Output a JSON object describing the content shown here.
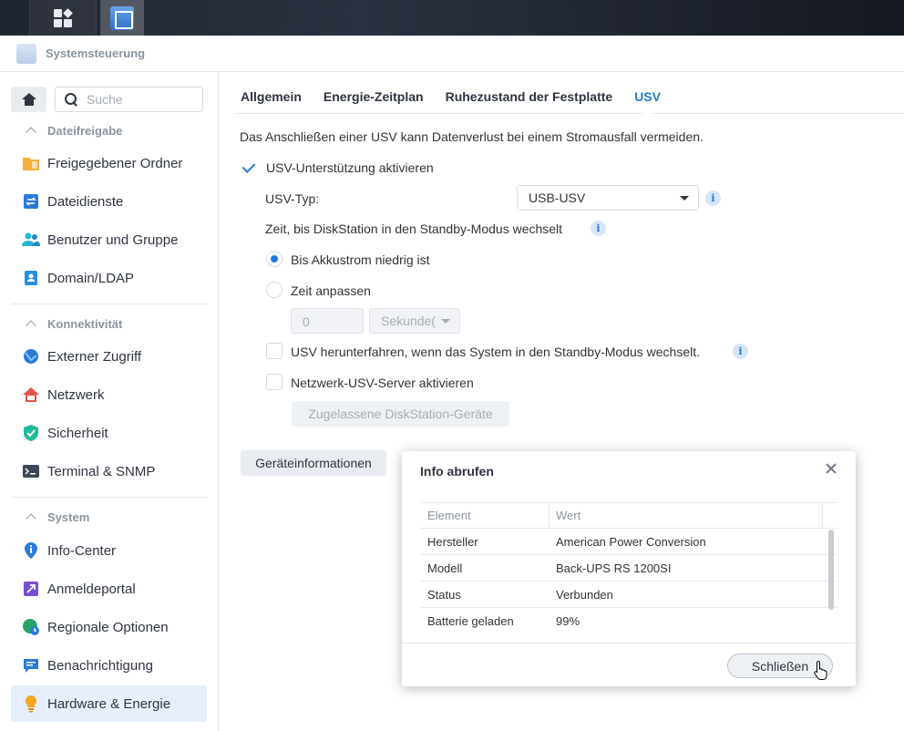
{
  "window": {
    "title": "Systemsteuerung"
  },
  "sidebar": {
    "search_placeholder": "Suche",
    "sections": {
      "dateifreigabe": "Dateifreigabe",
      "konnektivitaet": "Konnektivität",
      "system": "System"
    },
    "items": [
      {
        "label": "Freigegebener Ordner",
        "icon": "folder-icon",
        "color": "#f5a623"
      },
      {
        "label": "Dateidienste",
        "icon": "file-services-icon",
        "color": "#2b7ad8"
      },
      {
        "label": "Benutzer und Gruppe",
        "icon": "users-icon",
        "color": "#2bb3d9"
      },
      {
        "label": "Domain/LDAP",
        "icon": "id-card-icon",
        "color": "#2b8fe0"
      },
      {
        "label": "Externer Zugriff",
        "icon": "globe-link-icon",
        "color": "#2b7ad8"
      },
      {
        "label": "Netzwerk",
        "icon": "house-network-icon",
        "color": "#e2554a"
      },
      {
        "label": "Sicherheit",
        "icon": "shield-check-icon",
        "color": "#1fb99a"
      },
      {
        "label": "Terminal & SNMP",
        "icon": "terminal-icon",
        "color": "#3c4656"
      },
      {
        "label": "Info-Center",
        "icon": "info-pin-icon",
        "color": "#2b7ad8"
      },
      {
        "label": "Anmeldeportal",
        "icon": "portal-arrow-icon",
        "color": "#7a4fd0"
      },
      {
        "label": "Regionale Optionen",
        "icon": "globe-clock-icon",
        "color": "#2aa36b"
      },
      {
        "label": "Benachrichtigung",
        "icon": "chat-bubble-icon",
        "color": "#2b7ad8"
      },
      {
        "label": "Hardware & Energie",
        "icon": "lightbulb-icon",
        "color": "#f5a623",
        "active": true
      }
    ]
  },
  "tabs": [
    {
      "label": "Allgemein"
    },
    {
      "label": "Energie-Zeitplan"
    },
    {
      "label": "Ruhezustand der Festplatte"
    },
    {
      "label": "USV",
      "active": true
    }
  ],
  "usv": {
    "intro": "Das Anschließen einer USV kann Datenverlust bei einem Stromausfall vermeiden.",
    "enable_label": "USV-Unterstützung aktivieren",
    "enable_checked": true,
    "type_label": "USV-Typ:",
    "type_value": "USB-USV",
    "standby_label": "Zeit, bis DiskStation in den Standby-Modus wechselt",
    "radio_low_battery": "Bis Akkustrom niedrig ist",
    "radio_custom": "Zeit anpassen",
    "time_value": "0",
    "time_unit": "Sekunde(",
    "shutdown_label": "USV herunterfahren, wenn das System in den Standby-Modus wechselt.",
    "network_server_label": "Netzwerk-USV-Server aktivieren",
    "allowed_devices_button": "Zugelassene DiskStation-Geräte",
    "device_info_button": "Geräteinformationen"
  },
  "dialog": {
    "title": "Info abrufen",
    "columns": [
      "Element",
      "Wert"
    ],
    "rows": [
      [
        "Hersteller",
        "American Power Conversion"
      ],
      [
        "Modell",
        "Back-UPS RS 1200SI"
      ],
      [
        "Status",
        "Verbunden"
      ],
      [
        "Batterie geladen",
        "99%"
      ]
    ],
    "close_button": "Schließen"
  },
  "colors": {
    "accent": "#1f7ad6",
    "active_bg": "#e5eefa"
  }
}
